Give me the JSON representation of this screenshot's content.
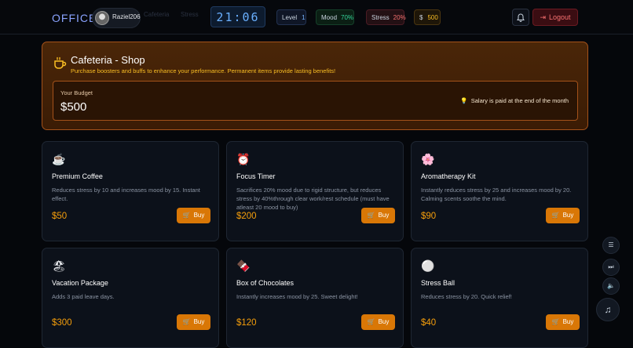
{
  "header": {
    "logo": "OFFICE",
    "username": "Raziel206",
    "faded_left": "Cafeteria",
    "faded_mid": "Stress",
    "clock": "21:06",
    "level_label": "Level",
    "level_value": "1",
    "mood_label": "Mood",
    "mood_value": "70%",
    "stress_label": "Stress",
    "stress_value": "20%",
    "money_symbol": "$",
    "money_value": "500",
    "logout_label": "Logout"
  },
  "shop": {
    "title": "Cafeteria - Shop",
    "subtitle": "Purchase boosters and buffs to enhance your performance. Permanent items provide lasting benefits!",
    "budget_label": "Your Budget",
    "budget_value": "$500",
    "salary_note": "Salary is paid at the end of the month"
  },
  "items": [
    {
      "icon": "coffee-icon",
      "glyph": "☕",
      "name": "Premium Coffee",
      "desc": "Reduces stress by 10 and increases mood by 15. Instant effect.",
      "price": "$50",
      "buy": "Buy"
    },
    {
      "icon": "timer-icon",
      "glyph": "⏰",
      "name": "Focus Timer",
      "desc": "Sacrifices 20% mood due to rigid structure, but reduces stress by 40%through clear work/rest schedule (must have atleast 20 mood to buy)",
      "price": "$200",
      "buy": "Buy"
    },
    {
      "icon": "flower-icon",
      "glyph": "🌸",
      "name": "Aromatherapy Kit",
      "desc": "Instantly reduces stress by 25 and increases mood by 20. Calming scents soothe the mind.",
      "price": "$90",
      "buy": "Buy"
    },
    {
      "icon": "beach-icon",
      "glyph": "🏖",
      "name": "Vacation Package",
      "desc": "Adds 3 paid leave days.",
      "price": "$300",
      "buy": "Buy"
    },
    {
      "icon": "chocolate-icon",
      "glyph": "🍫",
      "name": "Box of Chocolates",
      "desc": "Instantly increases mood by 25. Sweet delight!",
      "price": "$120",
      "buy": "Buy"
    },
    {
      "icon": "ball-icon",
      "glyph": "⚪",
      "name": "Stress Ball",
      "desc": "Reduces stress by 20. Quick relief!",
      "price": "$40",
      "buy": "Buy"
    }
  ],
  "colors": {
    "accent_orange": "#d97706",
    "price": "#f59e0b",
    "mood": "#34d399",
    "stress": "#f87171",
    "clock": "#6ab0ff"
  }
}
